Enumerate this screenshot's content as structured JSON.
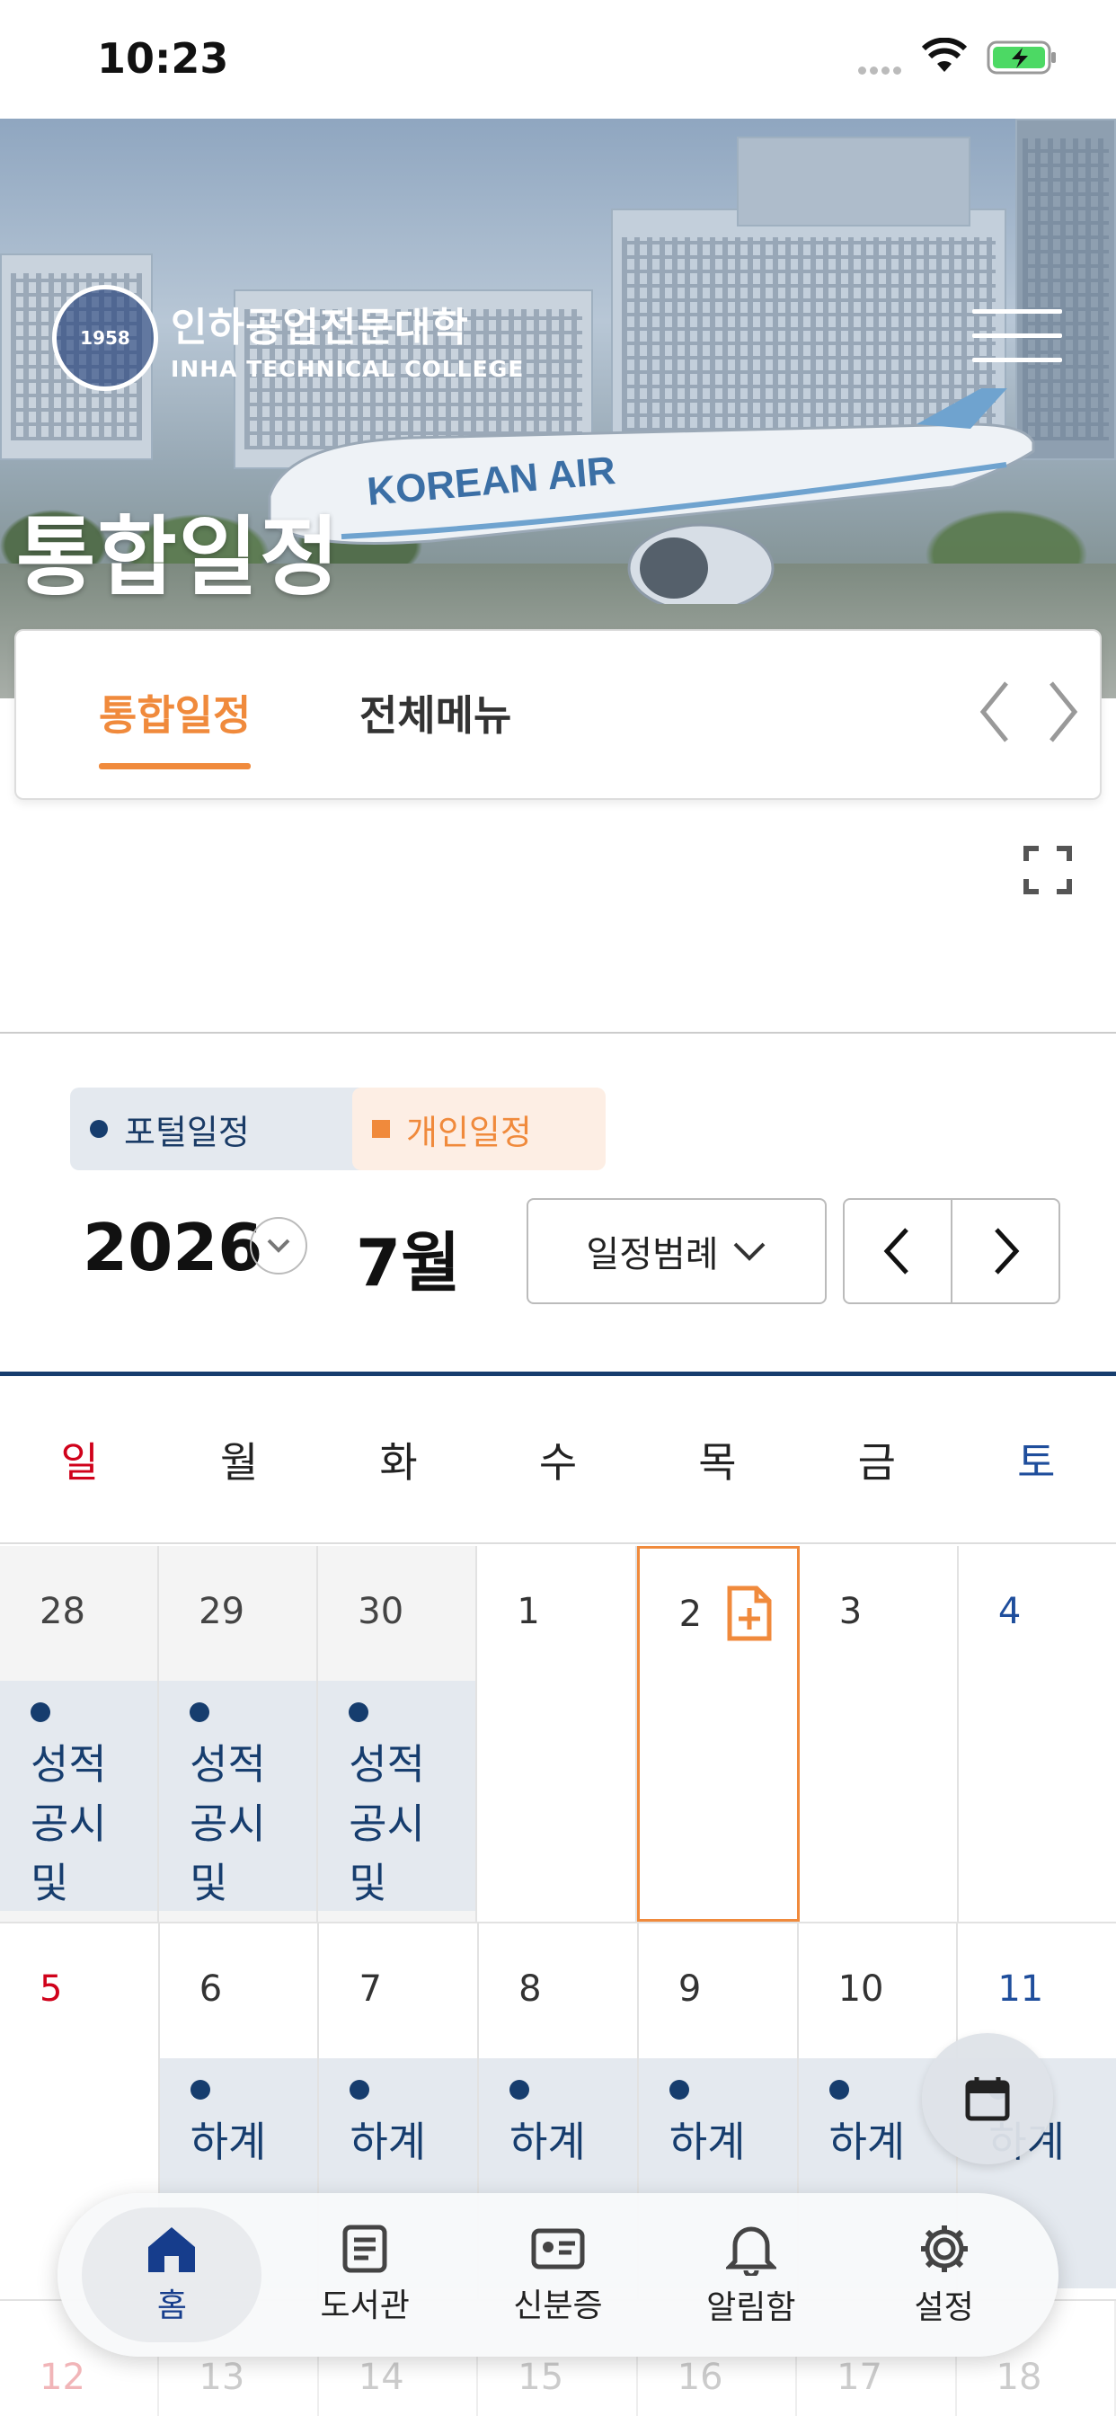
{
  "status": {
    "time": "10:23"
  },
  "header": {
    "logo_ko": "인하공업전문대학",
    "logo_en": "INHA TECHNICAL COLLEGE",
    "seal_year": "1958",
    "page_title": "통합일정"
  },
  "tabs": [
    {
      "label": "통합일정",
      "active": true
    },
    {
      "label": "전체메뉴",
      "active": false
    }
  ],
  "calendar": {
    "chip_portal": "포털일정",
    "chip_personal": "개인일정",
    "year": "2026",
    "month": "7월",
    "legend_button": "일정범례",
    "weekdays": [
      "일",
      "월",
      "화",
      "수",
      "목",
      "금",
      "토"
    ],
    "weeks": [
      [
        {
          "day": "28",
          "prev": true,
          "event": "성적공시및"
        },
        {
          "day": "29",
          "prev": true,
          "event": "성적공시및"
        },
        {
          "day": "30",
          "prev": true,
          "event": "성적공시및"
        },
        {
          "day": "1"
        },
        {
          "day": "2",
          "today": true
        },
        {
          "day": "3"
        },
        {
          "day": "4"
        }
      ],
      [
        {
          "day": "5"
        },
        {
          "day": "6",
          "event": "하계"
        },
        {
          "day": "7",
          "event": "하계"
        },
        {
          "day": "8",
          "event": "하계"
        },
        {
          "day": "9",
          "event": "하계"
        },
        {
          "day": "10",
          "event": "하계"
        },
        {
          "day": "11",
          "event": "하계"
        }
      ]
    ],
    "next_week_days": [
      "12",
      "13",
      "14",
      "15",
      "16",
      "17",
      "18"
    ]
  },
  "tabbar": [
    {
      "label": "홈",
      "icon": "home-icon",
      "active": true
    },
    {
      "label": "도서관",
      "icon": "book-icon"
    },
    {
      "label": "신분증",
      "icon": "id-card-icon"
    },
    {
      "label": "알림함",
      "icon": "bell-icon"
    },
    {
      "label": "설정",
      "icon": "gear-icon"
    }
  ],
  "colors": {
    "accent": "#f08a3c",
    "navy": "#163d6e",
    "sunday": "#d0021b",
    "saturday": "#1f4e9c"
  }
}
